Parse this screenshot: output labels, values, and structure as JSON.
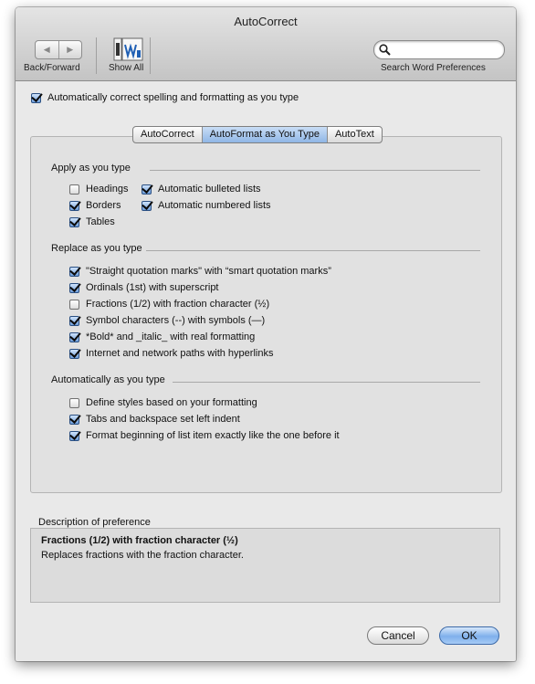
{
  "window": {
    "title": "AutoCorrect"
  },
  "toolbar": {
    "back_forward_label": "Back/Forward",
    "show_all_label": "Show All",
    "search_label": "Search Word Preferences",
    "search_value": "",
    "search_placeholder": ""
  },
  "master_option": {
    "label": "Automatically correct spelling and formatting as you type",
    "checked": true
  },
  "tabs": [
    {
      "label": "AutoCorrect",
      "active": false
    },
    {
      "label": "AutoFormat as You Type",
      "active": true
    },
    {
      "label": "AutoText",
      "active": false
    }
  ],
  "groups": {
    "apply": {
      "title": "Apply as you type",
      "options": [
        {
          "label": "Headings",
          "checked": false
        },
        {
          "label": "Borders",
          "checked": true
        },
        {
          "label": "Tables",
          "checked": true
        },
        {
          "label": "Automatic bulleted lists",
          "checked": true
        },
        {
          "label": "Automatic numbered lists",
          "checked": true
        }
      ]
    },
    "replace": {
      "title": "Replace as you type",
      "options": [
        {
          "label": "\"Straight quotation marks\" with “smart quotation marks”",
          "checked": true
        },
        {
          "label": "Ordinals (1st) with superscript",
          "checked": true
        },
        {
          "label": "Fractions (1/2) with fraction character (½)",
          "checked": false
        },
        {
          "label": "Symbol characters (--) with symbols (—)",
          "checked": true
        },
        {
          "label": "*Bold* and _italic_ with real formatting",
          "checked": true
        },
        {
          "label": "Internet and network paths with hyperlinks",
          "checked": true
        }
      ]
    },
    "auto": {
      "title": "Automatically as you type",
      "options": [
        {
          "label": "Define styles based on your formatting",
          "checked": false
        },
        {
          "label": "Tabs and backspace set left indent",
          "checked": true
        },
        {
          "label": "Format beginning of list item exactly like the one before it",
          "checked": true
        }
      ]
    }
  },
  "description": {
    "label": "Description of preference",
    "title": "Fractions (1/2) with fraction character (½)",
    "text": "Replaces fractions with the fraction character."
  },
  "buttons": {
    "cancel": "Cancel",
    "ok": "OK"
  },
  "icons": {
    "back": "back-arrow-icon",
    "forward": "forward-arrow-icon",
    "show_all": "show-all-icon",
    "search": "magnifier-icon"
  },
  "colors": {
    "accent": "#7fb0ec",
    "window_bg": "#e9e9e9"
  }
}
